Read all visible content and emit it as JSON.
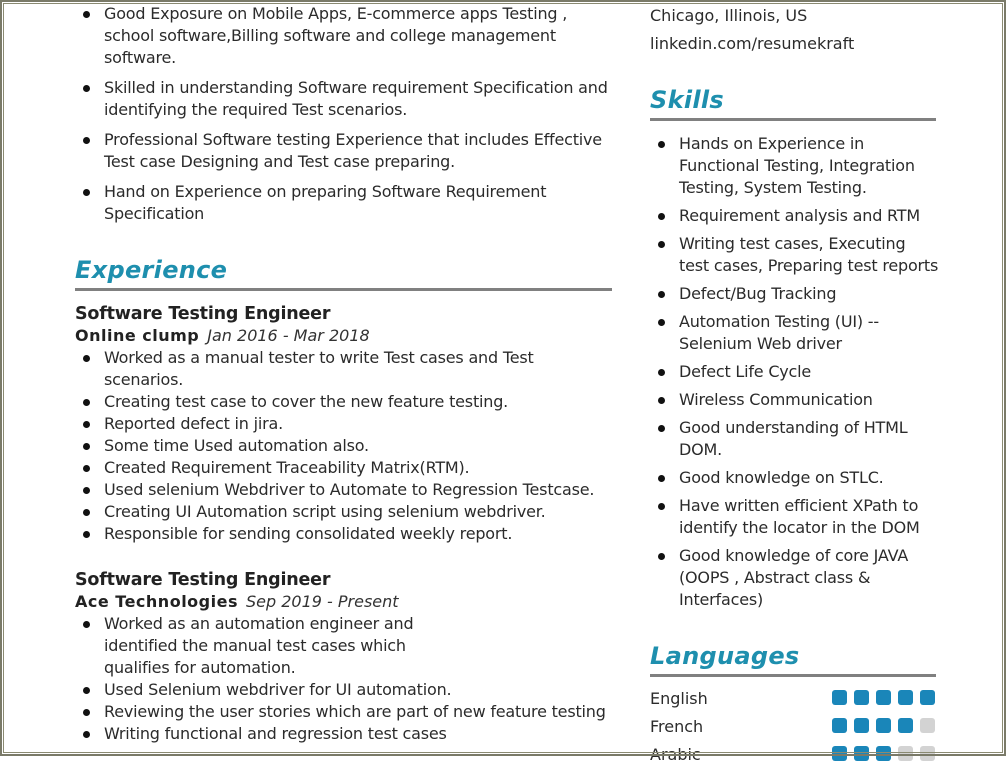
{
  "theme": {
    "accent": "#1e8fae",
    "rating_on": "#1a86b9",
    "rating_off": "#d3d3d3",
    "rule": "#808080"
  },
  "summary": {
    "items": [
      "Good Exposure on Mobile Apps, E-commerce apps Testing , school software,Billing software and college management software.",
      "Skilled in understanding Software requirement Specification and identifying the required Test scenarios.",
      "Professional Software testing Experience that includes Effective Test case Designing and Test case preparing.",
      "Hand on Experience on preparing Software Requirement Specification"
    ]
  },
  "experience": {
    "title": "Experience",
    "jobs": [
      {
        "title": "Software Testing Engineer",
        "company": "Online clump",
        "dates": "Jan 2016 - Mar 2018",
        "bullets": [
          "Worked as a manual tester to write Test cases and Test scenarios.",
          "Creating test case to cover the new feature testing.",
          "Reported defect in jira.",
          "Some time Used automation also.",
          "Created Requirement Traceability Matrix(RTM).",
          "Used selenium Webdriver to Automate to Regression Testcase.",
          "Creating UI Automation script using selenium  webdriver.",
          "Responsible for sending consolidated weekly report."
        ]
      },
      {
        "title": "Software Testing Engineer",
        "company": "Ace Technologies",
        "dates": "Sep 2019 - Present",
        "bullets": [
          "Worked as an automation engineer and identified the manual test cases which qualifies for automation.",
          "Used Selenium webdriver for UI automation.",
          "Reviewing the user stories which are part of new feature testing",
          "Writing functional and regression test cases"
        ]
      }
    ]
  },
  "contact": {
    "location": "Chicago, Illinois, US",
    "linkedin": "linkedin.com/resumekraft"
  },
  "skills": {
    "title": "Skills",
    "items": [
      "Hands on Experience in Functional Testing, Integration Testing, System Testing.",
      "Requirement analysis and RTM",
      "Writing test cases, Executing test cases, Preparing test reports",
      "Defect/Bug Tracking",
      "Automation Testing (UI) -- Selenium Web driver",
      "Defect Life Cycle",
      "Wireless Communication",
      "Good understanding of HTML DOM.",
      "Good knowledge on STLC.",
      "Have written efficient XPath to identify the locator in the DOM",
      "Good knowledge of core JAVA (OOPS , Abstract class & Interfaces)"
    ]
  },
  "languages": {
    "title": "Languages",
    "max_rating": 5,
    "items": [
      {
        "name": "English",
        "rating": 5
      },
      {
        "name": "French",
        "rating": 4
      },
      {
        "name": "Arabic",
        "rating": 3
      }
    ]
  }
}
